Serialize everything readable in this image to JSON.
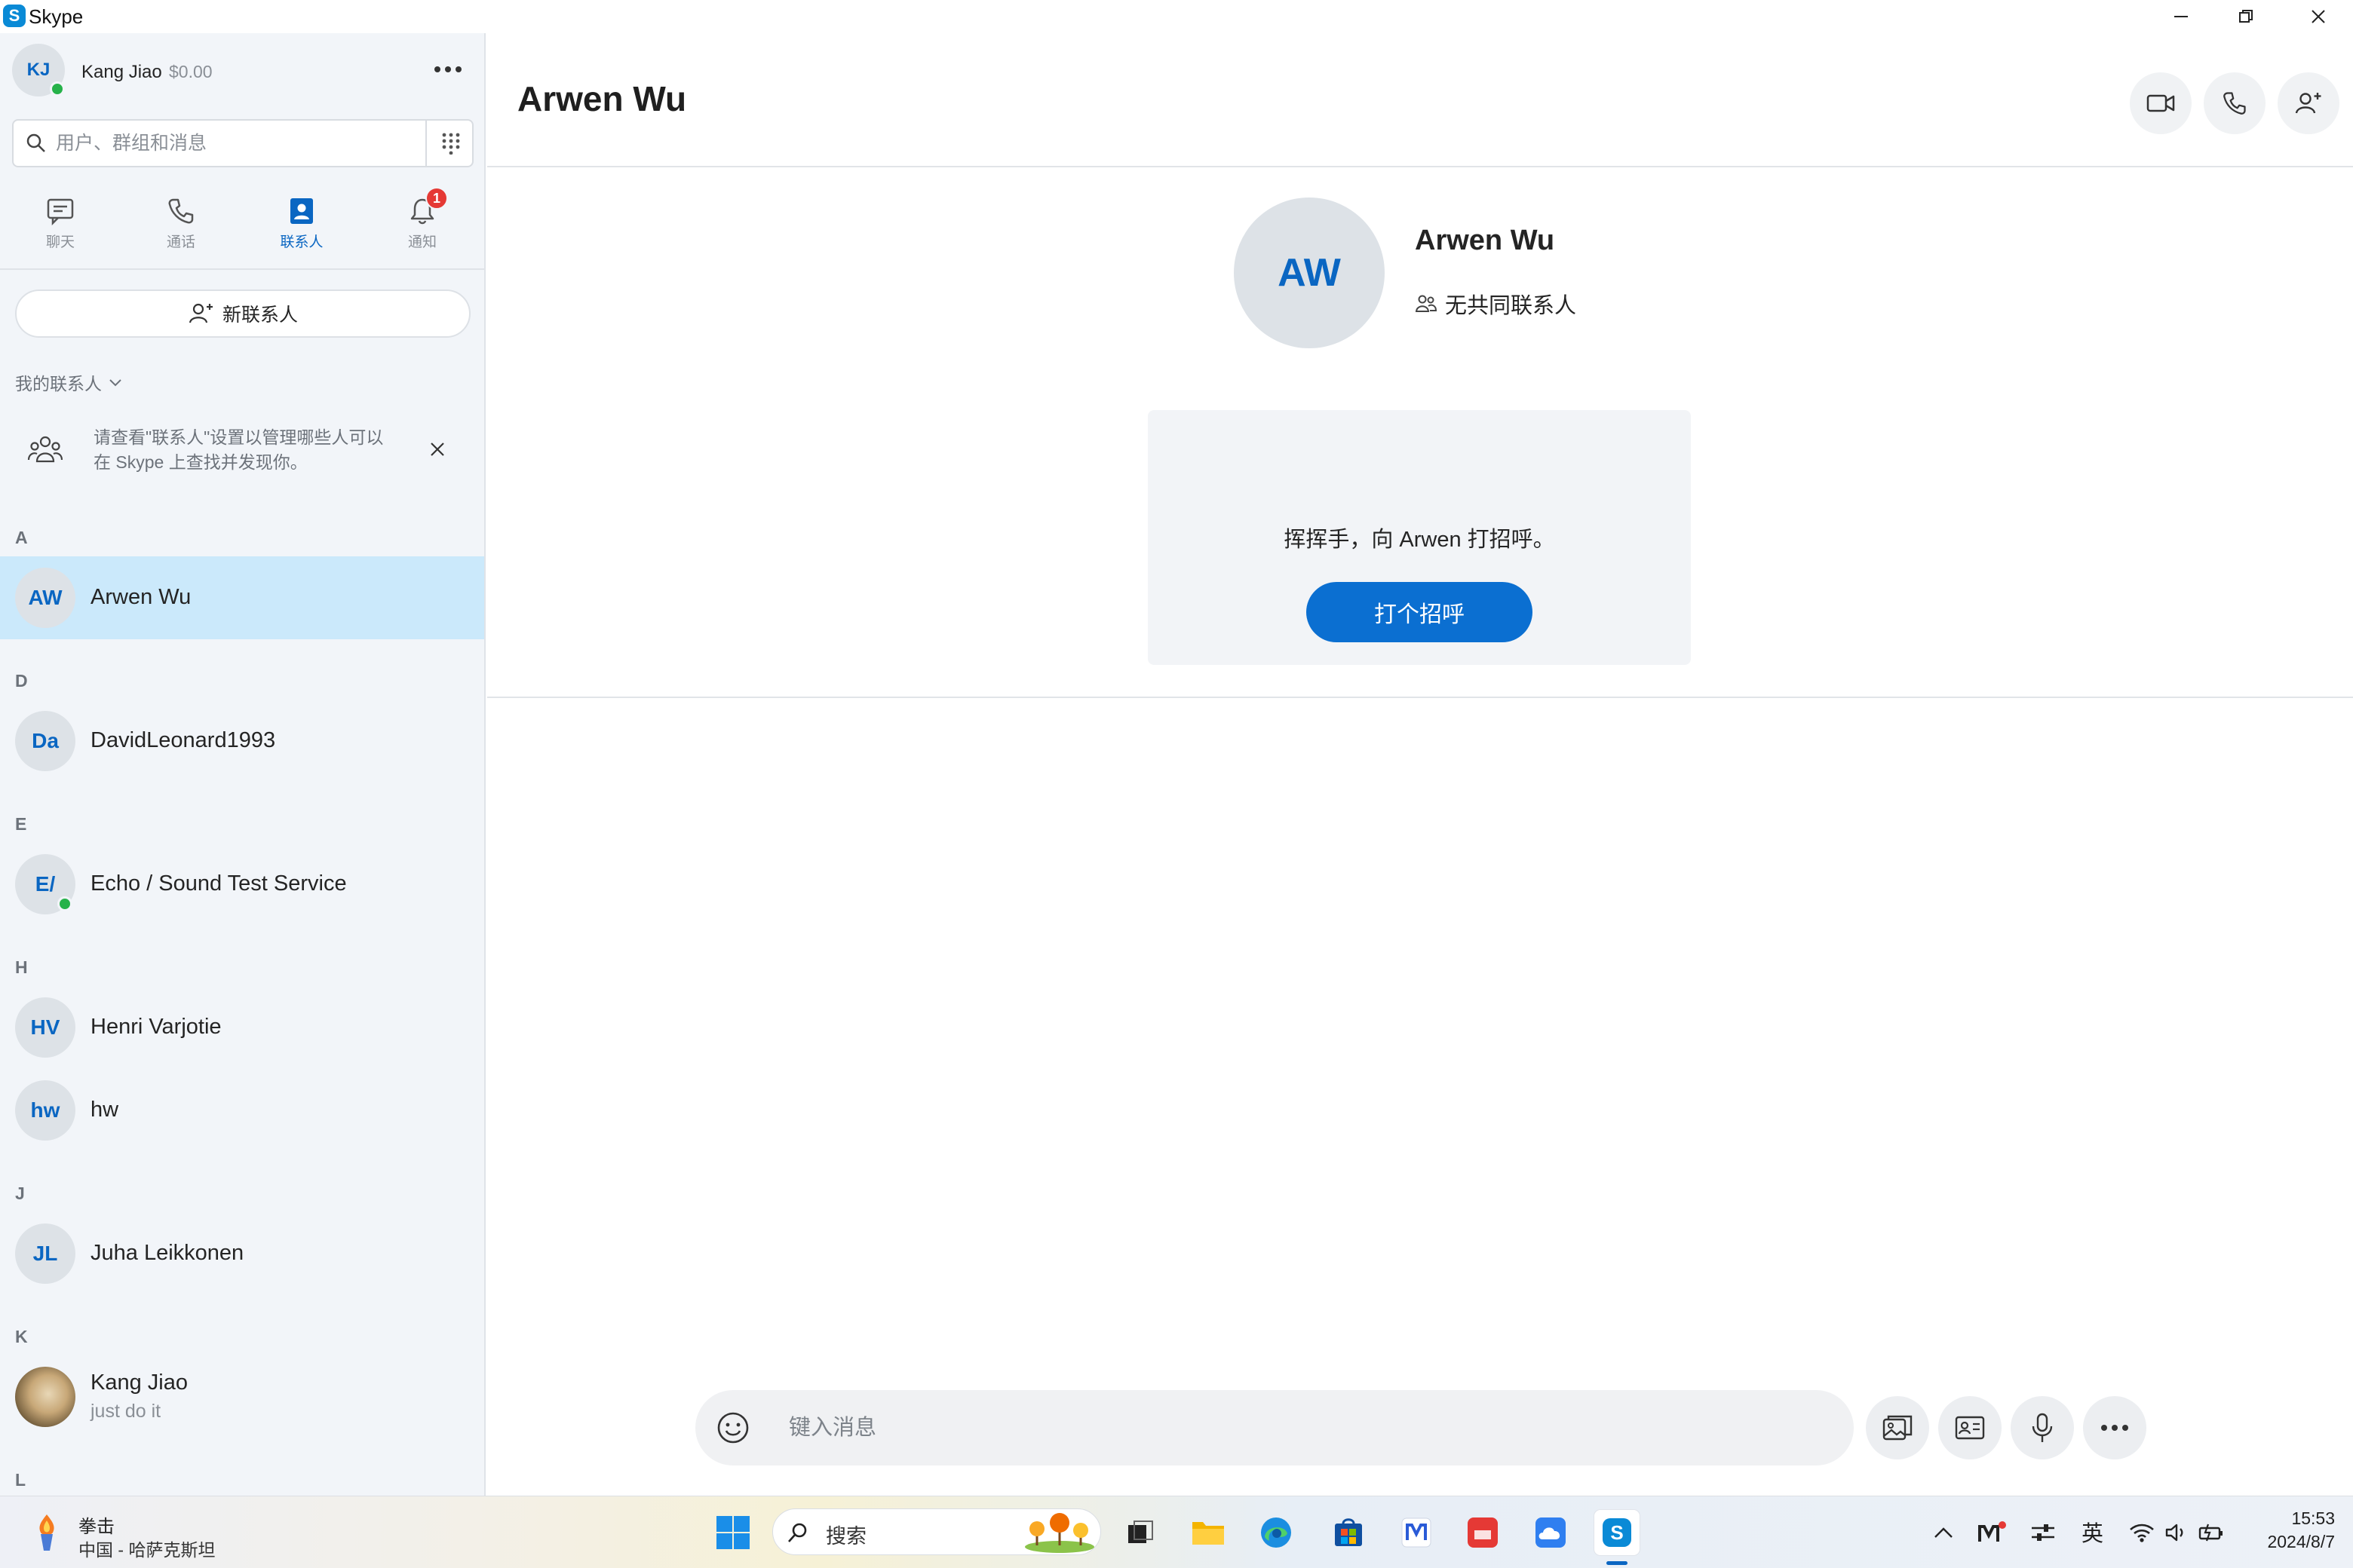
{
  "window": {
    "app_title": "Skype",
    "logo_letter": "S"
  },
  "profile": {
    "initials": "KJ",
    "name": "Kang Jiao",
    "credit": "$0.00"
  },
  "search": {
    "placeholder": "用户、群组和消息"
  },
  "nav": {
    "tabs": [
      {
        "label": "聊天",
        "icon": "chat-icon"
      },
      {
        "label": "通话",
        "icon": "phone-icon"
      },
      {
        "label": "联系人",
        "icon": "contacts-icon"
      },
      {
        "label": "通知",
        "icon": "bell-icon",
        "badge": "1"
      }
    ],
    "active_index": 2
  },
  "new_contact_label": "新联系人",
  "contacts_header": "我的联系人",
  "tip": {
    "line1": "请查看\"联系人\"设置以管理哪些人可以",
    "line2": "在 Skype 上查找并发现你。"
  },
  "contact_sections": [
    {
      "letter": "A",
      "contacts": [
        {
          "initials": "AW",
          "name": "Arwen Wu",
          "selected": true
        }
      ]
    },
    {
      "letter": "D",
      "contacts": [
        {
          "initials": "Da",
          "name": "DavidLeonard1993"
        }
      ]
    },
    {
      "letter": "E",
      "contacts": [
        {
          "initials": "E/",
          "name": "Echo / Sound Test Service",
          "online": true
        }
      ]
    },
    {
      "letter": "H",
      "contacts": [
        {
          "initials": "HV",
          "name": "Henri Varjotie"
        },
        {
          "initials": "hw",
          "name": "hw"
        }
      ]
    },
    {
      "letter": "J",
      "contacts": [
        {
          "initials": "JL",
          "name": "Juha Leikkonen"
        }
      ]
    },
    {
      "letter": "K",
      "contacts": [
        {
          "name": "Kang Jiao",
          "mood": "just do it",
          "photo": true
        }
      ]
    },
    {
      "letter": "L",
      "contacts": []
    }
  ],
  "chat": {
    "title": "Arwen Wu",
    "avatar_initials": "AW",
    "contact_name": "Arwen Wu",
    "mutual_contacts": "无共同联系人",
    "greeting": "挥挥手，向 Arwen 打招呼。",
    "greet_button": "打个招呼",
    "message_placeholder": "键入消息"
  },
  "taskbar": {
    "weather_title": "拳击",
    "weather_sub": "中国 - 哈萨克斯坦",
    "search_label": "搜索",
    "ime": "英",
    "time": "15:53",
    "date": "2024/8/7"
  },
  "colors": {
    "accent": "#0b6fd1",
    "selected_row": "#cbe9fb",
    "sidebar_bg": "#f2f5f9",
    "presence_online": "#26b24a",
    "badge": "#e53935"
  }
}
